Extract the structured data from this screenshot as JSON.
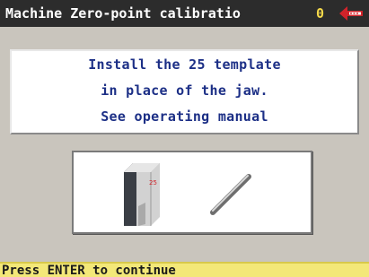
{
  "window": {
    "title": "Machine Zero-point calibratio",
    "counter": "0",
    "logo_icon": "keymachine-logo-icon"
  },
  "message": {
    "line1": "Install the 25 template",
    "line2": "in place of the jaw.",
    "line3": "See operating manual"
  },
  "illustration": {
    "template_label": "25",
    "template_icon": "template-block-icon",
    "rod_icon": "probe-rod-icon"
  },
  "status": {
    "prompt": "Press ENTER to continue"
  },
  "colors": {
    "titlebar_bg": "#2c2c2c",
    "screen_bg": "#c9c5bd",
    "message_text": "#1c2f86",
    "status_bg": "#f3e878",
    "logo_red": "#d0232a"
  }
}
